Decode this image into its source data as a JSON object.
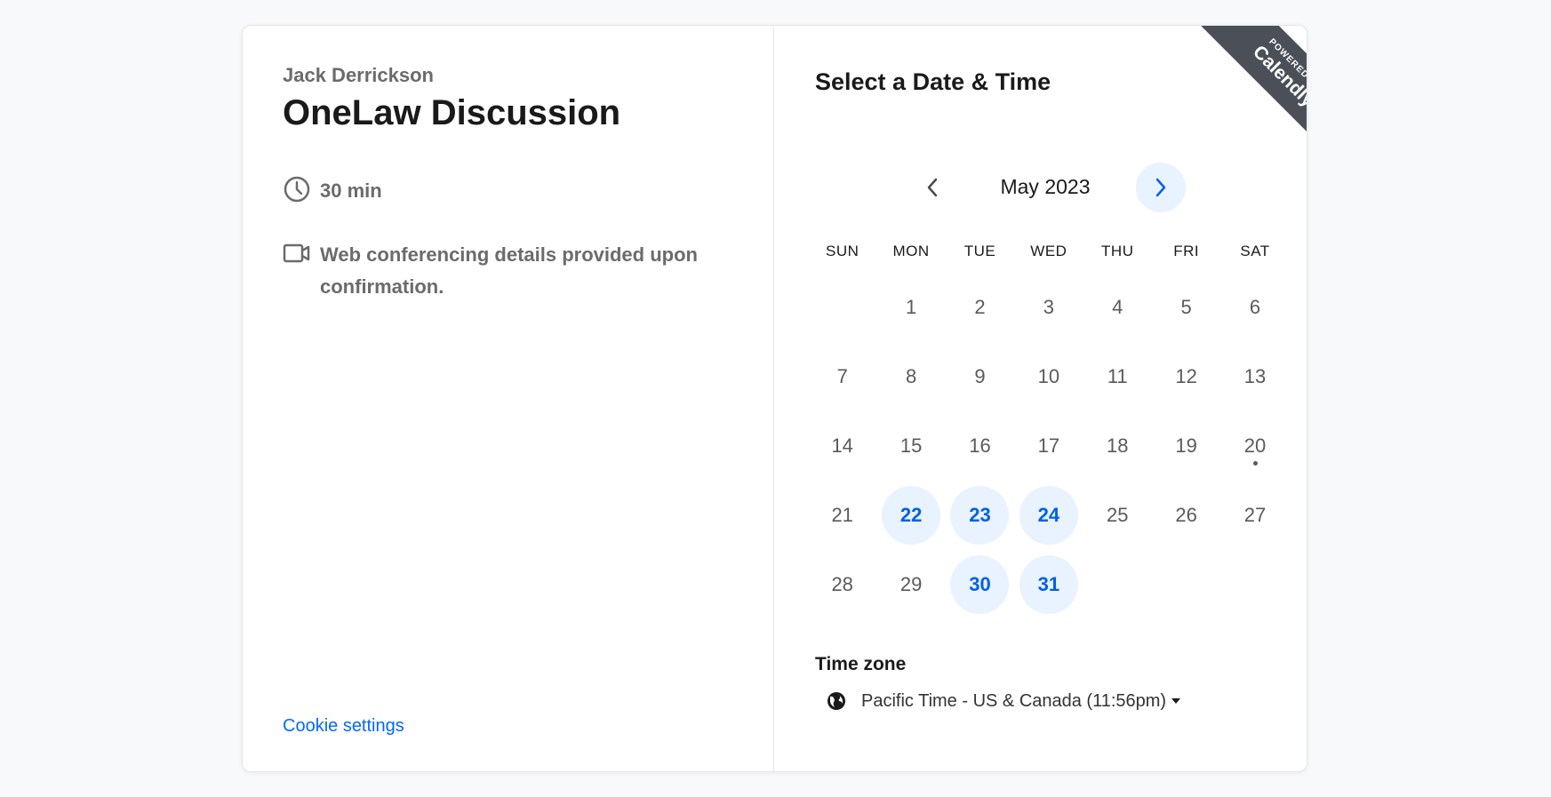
{
  "organizer": "Jack Derrickson",
  "event": {
    "title": "OneLaw Discussion",
    "duration": "30 min",
    "conferencing": "Web conferencing details provided upon confirmation."
  },
  "cookie_settings": "Cookie settings",
  "calendar": {
    "heading": "Select a Date & Time",
    "month_label": "May 2023",
    "weekdays": [
      "SUN",
      "MON",
      "TUE",
      "WED",
      "THU",
      "FRI",
      "SAT"
    ],
    "days": [
      {
        "label": ""
      },
      {
        "label": "1"
      },
      {
        "label": "2"
      },
      {
        "label": "3"
      },
      {
        "label": "4"
      },
      {
        "label": "5"
      },
      {
        "label": "6"
      },
      {
        "label": "7"
      },
      {
        "label": "8"
      },
      {
        "label": "9"
      },
      {
        "label": "10"
      },
      {
        "label": "11"
      },
      {
        "label": "12"
      },
      {
        "label": "13"
      },
      {
        "label": "14"
      },
      {
        "label": "15"
      },
      {
        "label": "16"
      },
      {
        "label": "17"
      },
      {
        "label": "18"
      },
      {
        "label": "19"
      },
      {
        "label": "20",
        "today": true
      },
      {
        "label": "21"
      },
      {
        "label": "22",
        "available": true
      },
      {
        "label": "23",
        "available": true
      },
      {
        "label": "24",
        "available": true
      },
      {
        "label": "25"
      },
      {
        "label": "26"
      },
      {
        "label": "27"
      },
      {
        "label": "28"
      },
      {
        "label": "29"
      },
      {
        "label": "30",
        "available": true
      },
      {
        "label": "31",
        "available": true
      }
    ]
  },
  "timezone": {
    "label": "Time zone",
    "value": "Pacific Time - US & Canada (11:56pm)"
  },
  "branding": {
    "powered_by": "POWERED BY",
    "brand": "Calendly"
  },
  "colors": {
    "accent": "#0069ff",
    "available_bg": "#e9f2ff",
    "ribbon": "#4b5058"
  }
}
